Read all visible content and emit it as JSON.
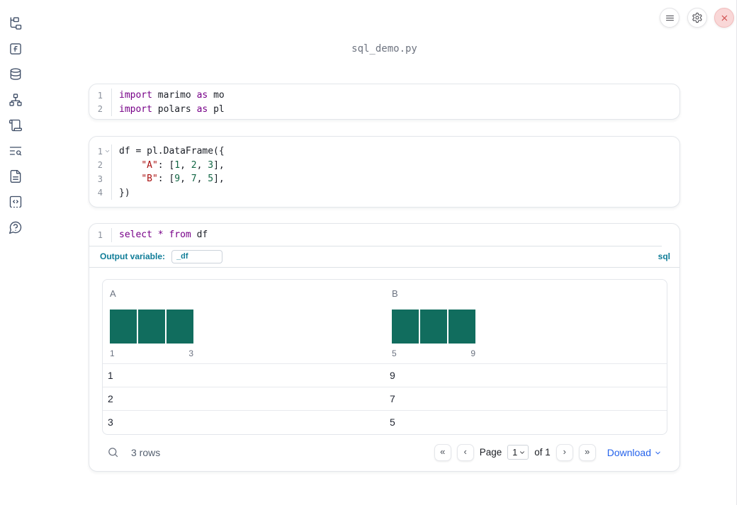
{
  "app": {
    "title": "sql_demo.py"
  },
  "topbar": {
    "menu_icon": "hamburger-menu",
    "settings_icon": "gear",
    "close_icon": "close-x"
  },
  "sidebar": {
    "items": [
      {
        "name": "file-explorer",
        "icon": "file-tree"
      },
      {
        "name": "variables",
        "icon": "function-square"
      },
      {
        "name": "data-sources",
        "icon": "database"
      },
      {
        "name": "dependencies",
        "icon": "network"
      },
      {
        "name": "scratchpad",
        "icon": "scroll"
      },
      {
        "name": "logs",
        "icon": "text-search"
      },
      {
        "name": "documentation",
        "icon": "file-text"
      },
      {
        "name": "snippets",
        "icon": "code-square"
      },
      {
        "name": "help",
        "icon": "help-bubble"
      }
    ]
  },
  "cells": [
    {
      "kind": "python",
      "lines": [
        {
          "num": "1",
          "tokens": [
            [
              "import",
              "keyword"
            ],
            [
              " marimo ",
              "plain"
            ],
            [
              "as",
              "keyword"
            ],
            [
              " mo",
              "plain"
            ]
          ]
        },
        {
          "num": "2",
          "tokens": [
            [
              "import",
              "keyword"
            ],
            [
              " polars ",
              "plain"
            ],
            [
              "as",
              "keyword"
            ],
            [
              " pl",
              "plain"
            ]
          ]
        }
      ]
    },
    {
      "kind": "python",
      "lines": [
        {
          "num": "1",
          "fold": true,
          "tokens": [
            [
              "df = pl.DataFrame({",
              "plain"
            ]
          ]
        },
        {
          "num": "2",
          "tokens": [
            [
              "    ",
              "plain"
            ],
            [
              "\"A\"",
              "string"
            ],
            [
              ": [",
              "plain"
            ],
            [
              "1",
              "number"
            ],
            [
              ", ",
              "plain"
            ],
            [
              "2",
              "number"
            ],
            [
              ", ",
              "plain"
            ],
            [
              "3",
              "number"
            ],
            [
              "],",
              "plain"
            ]
          ]
        },
        {
          "num": "3",
          "tokens": [
            [
              "    ",
              "plain"
            ],
            [
              "\"B\"",
              "string"
            ],
            [
              ": [",
              "plain"
            ],
            [
              "9",
              "number"
            ],
            [
              ", ",
              "plain"
            ],
            [
              "7",
              "number"
            ],
            [
              ", ",
              "plain"
            ],
            [
              "5",
              "number"
            ],
            [
              "],",
              "plain"
            ]
          ]
        },
        {
          "num": "4",
          "tokens": [
            [
              "})",
              "plain"
            ]
          ]
        }
      ]
    },
    {
      "kind": "sql",
      "lines": [
        {
          "num": "1",
          "tokens": [
            [
              "select",
              "keyword"
            ],
            [
              " ",
              "plain"
            ],
            [
              "*",
              "keyword"
            ],
            [
              " ",
              "plain"
            ],
            [
              "from",
              "keyword"
            ],
            [
              " df",
              "plain"
            ]
          ]
        }
      ]
    }
  ],
  "sql_cell": {
    "output_variable_label": "Output variable:",
    "output_variable_value": "_df",
    "language_badge": "sql"
  },
  "table": {
    "columns": [
      {
        "name": "A",
        "histogram": {
          "bars": [
            1,
            1,
            1
          ],
          "min_label": "1",
          "max_label": "3"
        }
      },
      {
        "name": "B",
        "histogram": {
          "bars": [
            1,
            1,
            1
          ],
          "min_label": "5",
          "max_label": "9"
        }
      }
    ],
    "rows": [
      [
        "1",
        "9"
      ],
      [
        "2",
        "7"
      ],
      [
        "3",
        "5"
      ]
    ],
    "footer": {
      "row_count": "3 rows",
      "first_page_glyph": "«",
      "prev_page_glyph": "‹",
      "page_label": "Page",
      "page_value": "1",
      "of_label": "of 1",
      "next_page_glyph": "›",
      "last_page_glyph": "»",
      "download_label": "Download"
    }
  },
  "colors": {
    "sql_accent": "#107d98",
    "download_link": "#2563eb",
    "histogram_bar": "#116d5e",
    "syntax_keyword": "#770088",
    "syntax_string": "#aa1111",
    "syntax_number": "#116644",
    "close_button_red": "#cc4444"
  }
}
